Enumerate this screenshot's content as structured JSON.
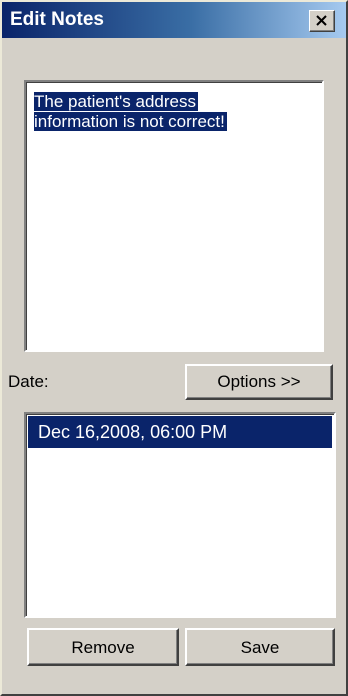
{
  "window": {
    "title": "Edit Notes"
  },
  "notes": {
    "lines": [
      "The patient's address",
      "information is not correct!"
    ]
  },
  "date_label": "Date:",
  "buttons": {
    "options": "Options >>",
    "remove": "Remove",
    "save": "Save"
  },
  "dates": {
    "items": [
      "Dec 16,2008, 06:00 PM"
    ],
    "selected_index": 0
  },
  "icons": {
    "close": "close-icon"
  },
  "colors": {
    "title_gradient_start": "#0a246a",
    "title_gradient_end": "#a6caf0",
    "selection": "#0a246a",
    "face": "#d4d0c8"
  }
}
